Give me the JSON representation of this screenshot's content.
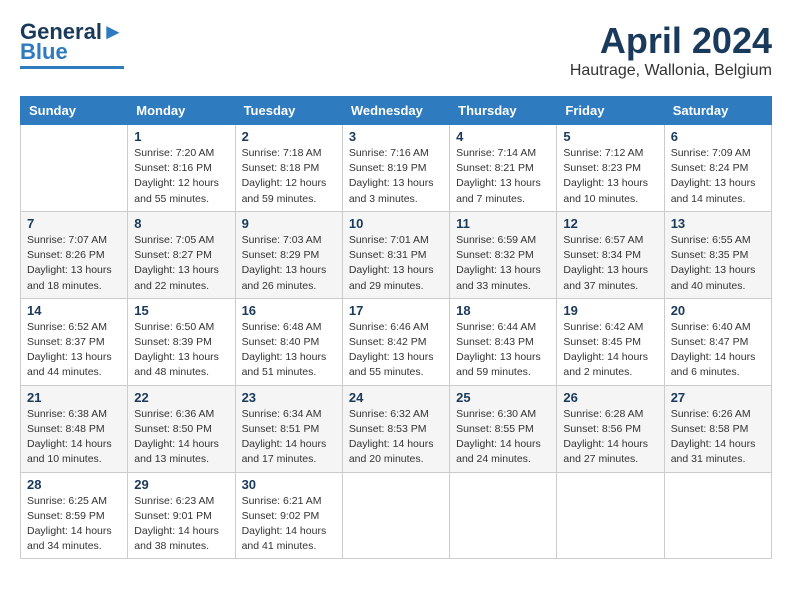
{
  "logo": {
    "line1": "General",
    "line2": "Blue"
  },
  "header": {
    "month": "April 2024",
    "location": "Hautrage, Wallonia, Belgium"
  },
  "weekdays": [
    "Sunday",
    "Monday",
    "Tuesday",
    "Wednesday",
    "Thursday",
    "Friday",
    "Saturday"
  ],
  "weeks": [
    [
      {
        "day": "",
        "info": ""
      },
      {
        "day": "1",
        "info": "Sunrise: 7:20 AM\nSunset: 8:16 PM\nDaylight: 12 hours\nand 55 minutes."
      },
      {
        "day": "2",
        "info": "Sunrise: 7:18 AM\nSunset: 8:18 PM\nDaylight: 12 hours\nand 59 minutes."
      },
      {
        "day": "3",
        "info": "Sunrise: 7:16 AM\nSunset: 8:19 PM\nDaylight: 13 hours\nand 3 minutes."
      },
      {
        "day": "4",
        "info": "Sunrise: 7:14 AM\nSunset: 8:21 PM\nDaylight: 13 hours\nand 7 minutes."
      },
      {
        "day": "5",
        "info": "Sunrise: 7:12 AM\nSunset: 8:23 PM\nDaylight: 13 hours\nand 10 minutes."
      },
      {
        "day": "6",
        "info": "Sunrise: 7:09 AM\nSunset: 8:24 PM\nDaylight: 13 hours\nand 14 minutes."
      }
    ],
    [
      {
        "day": "7",
        "info": "Sunrise: 7:07 AM\nSunset: 8:26 PM\nDaylight: 13 hours\nand 18 minutes."
      },
      {
        "day": "8",
        "info": "Sunrise: 7:05 AM\nSunset: 8:27 PM\nDaylight: 13 hours\nand 22 minutes."
      },
      {
        "day": "9",
        "info": "Sunrise: 7:03 AM\nSunset: 8:29 PM\nDaylight: 13 hours\nand 26 minutes."
      },
      {
        "day": "10",
        "info": "Sunrise: 7:01 AM\nSunset: 8:31 PM\nDaylight: 13 hours\nand 29 minutes."
      },
      {
        "day": "11",
        "info": "Sunrise: 6:59 AM\nSunset: 8:32 PM\nDaylight: 13 hours\nand 33 minutes."
      },
      {
        "day": "12",
        "info": "Sunrise: 6:57 AM\nSunset: 8:34 PM\nDaylight: 13 hours\nand 37 minutes."
      },
      {
        "day": "13",
        "info": "Sunrise: 6:55 AM\nSunset: 8:35 PM\nDaylight: 13 hours\nand 40 minutes."
      }
    ],
    [
      {
        "day": "14",
        "info": "Sunrise: 6:52 AM\nSunset: 8:37 PM\nDaylight: 13 hours\nand 44 minutes."
      },
      {
        "day": "15",
        "info": "Sunrise: 6:50 AM\nSunset: 8:39 PM\nDaylight: 13 hours\nand 48 minutes."
      },
      {
        "day": "16",
        "info": "Sunrise: 6:48 AM\nSunset: 8:40 PM\nDaylight: 13 hours\nand 51 minutes."
      },
      {
        "day": "17",
        "info": "Sunrise: 6:46 AM\nSunset: 8:42 PM\nDaylight: 13 hours\nand 55 minutes."
      },
      {
        "day": "18",
        "info": "Sunrise: 6:44 AM\nSunset: 8:43 PM\nDaylight: 13 hours\nand 59 minutes."
      },
      {
        "day": "19",
        "info": "Sunrise: 6:42 AM\nSunset: 8:45 PM\nDaylight: 14 hours\nand 2 minutes."
      },
      {
        "day": "20",
        "info": "Sunrise: 6:40 AM\nSunset: 8:47 PM\nDaylight: 14 hours\nand 6 minutes."
      }
    ],
    [
      {
        "day": "21",
        "info": "Sunrise: 6:38 AM\nSunset: 8:48 PM\nDaylight: 14 hours\nand 10 minutes."
      },
      {
        "day": "22",
        "info": "Sunrise: 6:36 AM\nSunset: 8:50 PM\nDaylight: 14 hours\nand 13 minutes."
      },
      {
        "day": "23",
        "info": "Sunrise: 6:34 AM\nSunset: 8:51 PM\nDaylight: 14 hours\nand 17 minutes."
      },
      {
        "day": "24",
        "info": "Sunrise: 6:32 AM\nSunset: 8:53 PM\nDaylight: 14 hours\nand 20 minutes."
      },
      {
        "day": "25",
        "info": "Sunrise: 6:30 AM\nSunset: 8:55 PM\nDaylight: 14 hours\nand 24 minutes."
      },
      {
        "day": "26",
        "info": "Sunrise: 6:28 AM\nSunset: 8:56 PM\nDaylight: 14 hours\nand 27 minutes."
      },
      {
        "day": "27",
        "info": "Sunrise: 6:26 AM\nSunset: 8:58 PM\nDaylight: 14 hours\nand 31 minutes."
      }
    ],
    [
      {
        "day": "28",
        "info": "Sunrise: 6:25 AM\nSunset: 8:59 PM\nDaylight: 14 hours\nand 34 minutes."
      },
      {
        "day": "29",
        "info": "Sunrise: 6:23 AM\nSunset: 9:01 PM\nDaylight: 14 hours\nand 38 minutes."
      },
      {
        "day": "30",
        "info": "Sunrise: 6:21 AM\nSunset: 9:02 PM\nDaylight: 14 hours\nand 41 minutes."
      },
      {
        "day": "",
        "info": ""
      },
      {
        "day": "",
        "info": ""
      },
      {
        "day": "",
        "info": ""
      },
      {
        "day": "",
        "info": ""
      }
    ]
  ]
}
